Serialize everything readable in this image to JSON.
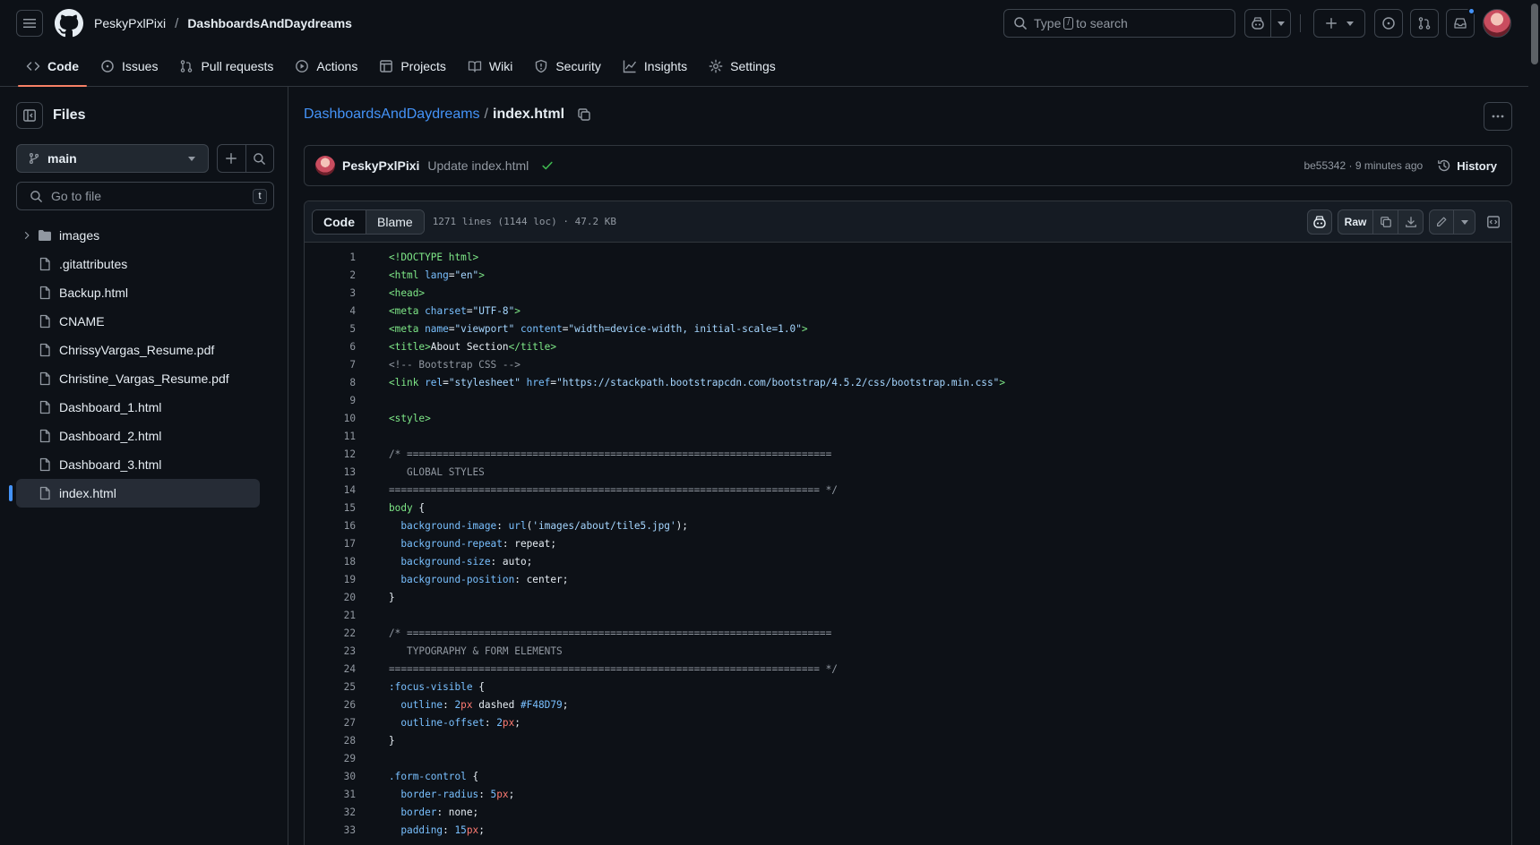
{
  "header": {
    "owner": "PeskyPxlPixi",
    "slash": "/",
    "repo": "DashboardsAndDaydreams",
    "search_prefix": "Type",
    "search_key": "/",
    "search_suffix": "to search"
  },
  "tabs": [
    {
      "label": "Code",
      "icon": "code-icon",
      "active": true
    },
    {
      "label": "Issues",
      "icon": "issue-icon"
    },
    {
      "label": "Pull requests",
      "icon": "pull-request-icon"
    },
    {
      "label": "Actions",
      "icon": "play-icon"
    },
    {
      "label": "Projects",
      "icon": "table-icon"
    },
    {
      "label": "Wiki",
      "icon": "book-icon"
    },
    {
      "label": "Security",
      "icon": "shield-icon"
    },
    {
      "label": "Insights",
      "icon": "graph-icon"
    },
    {
      "label": "Settings",
      "icon": "gear-icon"
    }
  ],
  "sidebar": {
    "title": "Files",
    "branch": "main",
    "goto_placeholder": "Go to file",
    "goto_key": "t",
    "tree": [
      {
        "label": "images",
        "type": "folder"
      },
      {
        "label": ".gitattributes",
        "type": "file"
      },
      {
        "label": "Backup.html",
        "type": "file"
      },
      {
        "label": "CNAME",
        "type": "file"
      },
      {
        "label": "ChrissyVargas_Resume.pdf",
        "type": "file"
      },
      {
        "label": "Christine_Vargas_Resume.pdf",
        "type": "file"
      },
      {
        "label": "Dashboard_1.html",
        "type": "file"
      },
      {
        "label": "Dashboard_2.html",
        "type": "file"
      },
      {
        "label": "Dashboard_3.html",
        "type": "file"
      },
      {
        "label": "index.html",
        "type": "file",
        "selected": true
      }
    ]
  },
  "breadcrumb": {
    "repo": "DashboardsAndDaydreams",
    "sep": "/",
    "file": "index.html"
  },
  "commit": {
    "author": "PeskyPxlPixi",
    "message": "Update index.html",
    "sha_time": "be55342 · 9 minutes ago",
    "history": "History"
  },
  "code_toolbar": {
    "code_tab": "Code",
    "blame_tab": "Blame",
    "meta": "1271 lines (1144 loc) · 47.2 KB",
    "raw": "Raw"
  },
  "code_lines": [
    {
      "n": "1",
      "segs": [
        [
          "t-tag",
          "<!DOCTYPE html>"
        ]
      ]
    },
    {
      "n": "2",
      "segs": [
        [
          "t-tag",
          "<html"
        ],
        [
          "t-attr",
          " lang"
        ],
        [
          "t-val",
          "="
        ],
        [
          "t-str",
          "\"en\""
        ],
        [
          "t-tag",
          ">"
        ]
      ]
    },
    {
      "n": "3",
      "segs": [
        [
          "t-tag",
          "<head>"
        ]
      ]
    },
    {
      "n": "4",
      "segs": [
        [
          "t-tag",
          "<meta"
        ],
        [
          "t-attr",
          " charset"
        ],
        [
          "t-val",
          "="
        ],
        [
          "t-str",
          "\"UTF-8\""
        ],
        [
          "t-tag",
          ">"
        ]
      ]
    },
    {
      "n": "5",
      "segs": [
        [
          "t-tag",
          "<meta"
        ],
        [
          "t-attr",
          " name"
        ],
        [
          "t-val",
          "="
        ],
        [
          "t-str",
          "\"viewport\""
        ],
        [
          "t-attr",
          " content"
        ],
        [
          "t-val",
          "="
        ],
        [
          "t-str",
          "\"width=device-width, initial-scale=1.0\""
        ],
        [
          "t-tag",
          ">"
        ]
      ]
    },
    {
      "n": "6",
      "segs": [
        [
          "t-tag",
          "<title>"
        ],
        [
          "t-val",
          "About Section"
        ],
        [
          "t-tag",
          "</title>"
        ]
      ]
    },
    {
      "n": "7",
      "segs": [
        [
          "t-com",
          "<!-- Bootstrap CSS -->"
        ]
      ]
    },
    {
      "n": "8",
      "segs": [
        [
          "t-tag",
          "<link"
        ],
        [
          "t-attr",
          " rel"
        ],
        [
          "t-val",
          "="
        ],
        [
          "t-str",
          "\"stylesheet\""
        ],
        [
          "t-attr",
          " href"
        ],
        [
          "t-val",
          "="
        ],
        [
          "t-str",
          "\"https://stackpath.bootstrapcdn.com/bootstrap/4.5.2/css/bootstrap.min.css\""
        ],
        [
          "t-tag",
          ">"
        ]
      ]
    },
    {
      "n": "9",
      "segs": []
    },
    {
      "n": "10",
      "segs": [
        [
          "t-tag",
          "<style>"
        ]
      ]
    },
    {
      "n": "11",
      "segs": []
    },
    {
      "n": "12",
      "segs": [
        [
          "t-com",
          "/* ======================================================================="
        ]
      ]
    },
    {
      "n": "13",
      "segs": [
        [
          "t-com",
          "   GLOBAL STYLES"
        ]
      ]
    },
    {
      "n": "14",
      "segs": [
        [
          "t-com",
          "======================================================================== */"
        ]
      ]
    },
    {
      "n": "15",
      "segs": [
        [
          "t-tag",
          "body"
        ],
        [
          "t-val",
          " {"
        ]
      ]
    },
    {
      "n": "16",
      "segs": [
        [
          "t-prop",
          "  background-image"
        ],
        [
          "t-val",
          ": "
        ],
        [
          "t-attr",
          "url"
        ],
        [
          "t-val",
          "("
        ],
        [
          "t-str",
          "'images/about/tile5.jpg'"
        ],
        [
          "t-val",
          ");"
        ]
      ]
    },
    {
      "n": "17",
      "segs": [
        [
          "t-prop",
          "  background-repeat"
        ],
        [
          "t-val",
          ": repeat;"
        ]
      ]
    },
    {
      "n": "18",
      "segs": [
        [
          "t-prop",
          "  background-size"
        ],
        [
          "t-val",
          ": auto;"
        ]
      ]
    },
    {
      "n": "19",
      "segs": [
        [
          "t-prop",
          "  background-position"
        ],
        [
          "t-val",
          ": center;"
        ]
      ]
    },
    {
      "n": "20",
      "segs": [
        [
          "t-val",
          "}"
        ]
      ]
    },
    {
      "n": "21",
      "segs": []
    },
    {
      "n": "22",
      "segs": [
        [
          "t-com",
          "/* ======================================================================="
        ]
      ]
    },
    {
      "n": "23",
      "segs": [
        [
          "t-com",
          "   TYPOGRAPHY & FORM ELEMENTS"
        ]
      ]
    },
    {
      "n": "24",
      "segs": [
        [
          "t-com",
          "======================================================================== */"
        ]
      ]
    },
    {
      "n": "25",
      "segs": [
        [
          "t-attr",
          ":focus-visible"
        ],
        [
          "t-val",
          " {"
        ]
      ]
    },
    {
      "n": "26",
      "segs": [
        [
          "t-prop",
          "  outline"
        ],
        [
          "t-val",
          ": "
        ],
        [
          "t-num",
          "2"
        ],
        [
          "t-kw",
          "px"
        ],
        [
          "t-val",
          " dashed "
        ],
        [
          "t-num",
          "#F48D79"
        ],
        [
          "t-val",
          ";"
        ]
      ]
    },
    {
      "n": "27",
      "segs": [
        [
          "t-prop",
          "  outline-offset"
        ],
        [
          "t-val",
          ": "
        ],
        [
          "t-num",
          "2"
        ],
        [
          "t-kw",
          "px"
        ],
        [
          "t-val",
          ";"
        ]
      ]
    },
    {
      "n": "28",
      "segs": [
        [
          "t-val",
          "}"
        ]
      ]
    },
    {
      "n": "29",
      "segs": []
    },
    {
      "n": "30",
      "segs": [
        [
          "t-attr",
          ".form-control"
        ],
        [
          "t-val",
          " {"
        ]
      ]
    },
    {
      "n": "31",
      "segs": [
        [
          "t-prop",
          "  border-radius"
        ],
        [
          "t-val",
          ": "
        ],
        [
          "t-num",
          "5"
        ],
        [
          "t-kw",
          "px"
        ],
        [
          "t-val",
          ";"
        ]
      ]
    },
    {
      "n": "32",
      "segs": [
        [
          "t-prop",
          "  border"
        ],
        [
          "t-val",
          ": none;"
        ]
      ]
    },
    {
      "n": "33",
      "segs": [
        [
          "t-prop",
          "  padding"
        ],
        [
          "t-val",
          ": "
        ],
        [
          "t-num",
          "15"
        ],
        [
          "t-kw",
          "px"
        ],
        [
          "t-val",
          ";"
        ]
      ]
    }
  ]
}
